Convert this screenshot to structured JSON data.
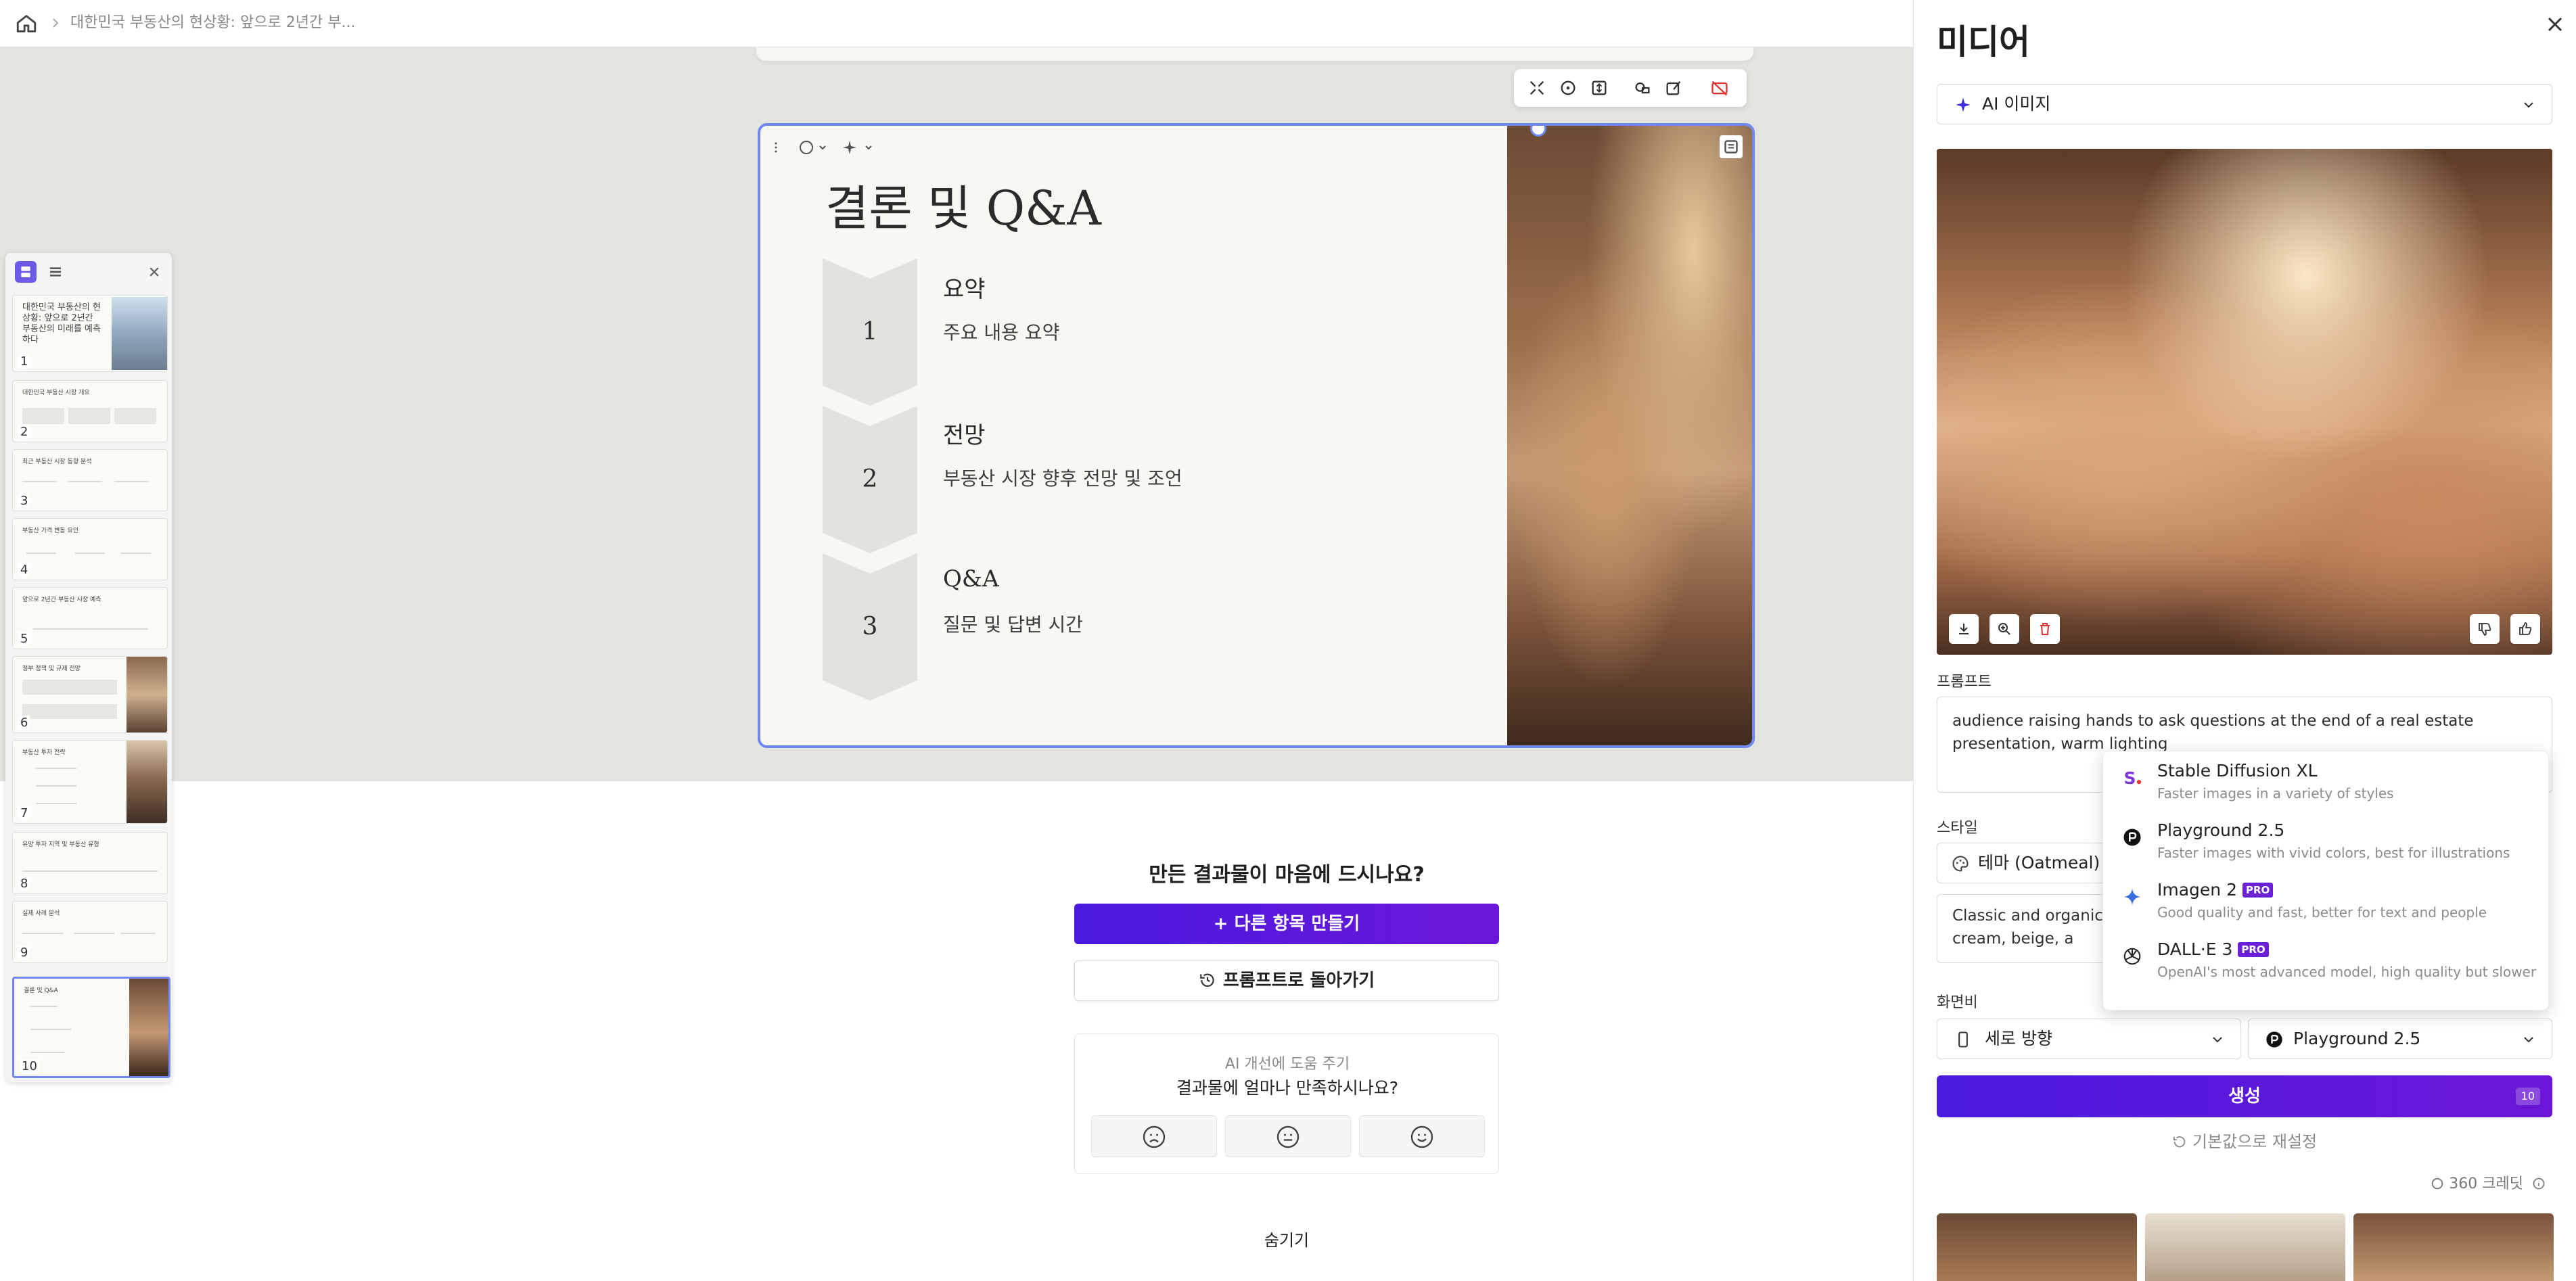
{
  "breadcrumb": {
    "title": "대한민국 부동산의 현상황: 앞으로 2년간 부..."
  },
  "slide": {
    "title": "결론 및 Q&A",
    "items": [
      {
        "num": "1",
        "heading": "요약",
        "desc": "주요 내용 요약"
      },
      {
        "num": "2",
        "heading": "전망",
        "desc": "부동산 시장 향후 전망 및 조언"
      },
      {
        "num": "3",
        "heading": "Q&A",
        "desc": "질문 및 답변 시간"
      }
    ]
  },
  "thumbnails": [
    {
      "num": "1",
      "title": "대한민국 부동산의 현상황: 앞으로 2년간 부동산의 미래를 예측하다"
    },
    {
      "num": "2",
      "title": "대한민국 부동산 시장 개요"
    },
    {
      "num": "3",
      "title": "최근 부동산 시장 동향 분석"
    },
    {
      "num": "4",
      "title": "부동산 가격 변동 요인"
    },
    {
      "num": "5",
      "title": "앞으로 2년간 부동산 시장 예측"
    },
    {
      "num": "6",
      "title": "정부 정책 및 규제 전망"
    },
    {
      "num": "7",
      "title": "부동산 투자 전략"
    },
    {
      "num": "8",
      "title": "유망 투자 지역 및 부동산 유형"
    },
    {
      "num": "9",
      "title": "실제 사례 분석"
    },
    {
      "num": "10",
      "title": "결론 및 Q&A"
    }
  ],
  "feedback": {
    "question": "만든 결과물이 마음에 드시나요?",
    "make_another": "+ 다른 항목 만들기",
    "back_to_prompt": "프롬프트로 돌아가기",
    "help_label": "AI 개선에 도움 주기",
    "satisfaction": "결과물에 얼마나 만족하시나요?",
    "hide": "숨기기"
  },
  "media": {
    "title": "미디어",
    "type_select": "AI 이미지",
    "prompt_label": "프롬프트",
    "prompt_text": "audience raising hands to ask questions at the end of a real estate presentation, warm lighting",
    "style_label": "스타일",
    "style_value": "테마 (Oatmeal)",
    "style_desc": "Classic and organic like cream, beige, a",
    "ratio_label": "화면비",
    "orientation": "세로 방향",
    "model": "Playground 2.5",
    "generate": "생성",
    "generate_cost": "10",
    "reset": "기본값으로 재설정",
    "credits": "360 크레딧"
  },
  "model_dropdown": {
    "options": [
      {
        "name": "Stable Diffusion XL",
        "desc": "Faster images in a variety of styles",
        "pro": ""
      },
      {
        "name": "Playground 2.5",
        "desc": "Faster images with vivid colors, best for illustrations",
        "pro": ""
      },
      {
        "name": "Imagen 2",
        "desc": "Good quality and fast, better for text and people",
        "pro": "PRO"
      },
      {
        "name": "DALL·E 3",
        "desc": "OpenAI's most advanced model, high quality but slower",
        "pro": "PRO"
      }
    ]
  },
  "colors": {
    "accent": "#5b18dd",
    "selection": "#6e87f3",
    "canvas": "#e3e3df"
  }
}
